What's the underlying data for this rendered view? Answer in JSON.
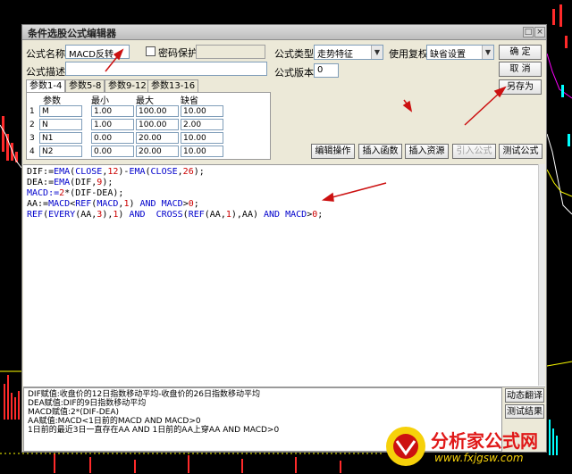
{
  "window": {
    "title": "条件选股公式编辑器"
  },
  "form": {
    "name_label": "公式名称",
    "name_value": "MACD反转",
    "password_label": "密码保护",
    "desc_label": "公式描述",
    "desc_value": "",
    "type_label": "公式类型",
    "type_value": "走势特征",
    "rights_label": "使用复权",
    "rights_value": "缺省设置",
    "version_label": "公式版本",
    "version_value": "0"
  },
  "buttons": {
    "ok": "确  定",
    "cancel": "取  消",
    "save_as": "另存为",
    "edit_ops": "编辑操作",
    "insert_func": "插入函数",
    "insert_res": "插入资源",
    "import": "引入公式",
    "test": "测试公式",
    "dyn_translate": "动态翻译",
    "test_result": "测试结果"
  },
  "tabs": [
    "参数1-4",
    "参数5-8",
    "参数9-12",
    "参数13-16"
  ],
  "params": {
    "headers": [
      "参数",
      "最小",
      "最大",
      "缺省"
    ],
    "rows": [
      {
        "idx": "1",
        "name": "M",
        "min": "1.00",
        "max": "100.00",
        "def": "10.00"
      },
      {
        "idx": "2",
        "name": "N",
        "min": "1.00",
        "max": "100.00",
        "def": "2.00"
      },
      {
        "idx": "3",
        "name": "N1",
        "min": "0.00",
        "max": "20.00",
        "def": "10.00"
      },
      {
        "idx": "4",
        "name": "N2",
        "min": "0.00",
        "max": "20.00",
        "def": "10.00"
      }
    ]
  },
  "code": {
    "l1": [
      "DIF:=",
      "EMA",
      "(",
      "CLOSE",
      ",",
      "12",
      ")-",
      "EMA",
      "(",
      "CLOSE",
      ",",
      "26",
      ");"
    ],
    "l2": [
      "DEA:=",
      "EMA",
      "(DIF,",
      "9",
      ");"
    ],
    "l3": [
      "MACD:=",
      "2",
      "*(DIF-DEA);"
    ],
    "l4": [
      "AA:=",
      "MACD",
      "<",
      "REF",
      "(",
      "MACD",
      ",",
      "1",
      ") ",
      "AND",
      " ",
      "MACD",
      ">",
      "0",
      ";"
    ],
    "l5": [
      "REF",
      "(",
      "EVERY",
      "(AA,",
      "3",
      "),",
      "1",
      ") ",
      "AND",
      "  ",
      "CROSS",
      "(",
      "REF",
      "(AA,",
      "1",
      "),AA) ",
      "AND",
      " ",
      "MACD",
      ">",
      "0",
      ";"
    ]
  },
  "info_lines": [
    "DIF赋值:收盘价的12日指数移动平均-收盘价的26日指数移动平均",
    "DEA赋值:DIF的9日指数移动平均",
    "MACD赋值:2*(DIF-DEA)",
    "AA赋值:MACD<1日前的MACD AND MACD>0",
    "1日前的最近3日一直存在AA AND  1日前的AA上穿AA AND MACD>0"
  ],
  "watermark": {
    "cn": "分析家公式网",
    "url": "www.fxjgsw.com"
  },
  "colors": {
    "accent_red": "#cc1111",
    "keyword_blue": "#0000cc",
    "number_red": "#cc0000"
  }
}
